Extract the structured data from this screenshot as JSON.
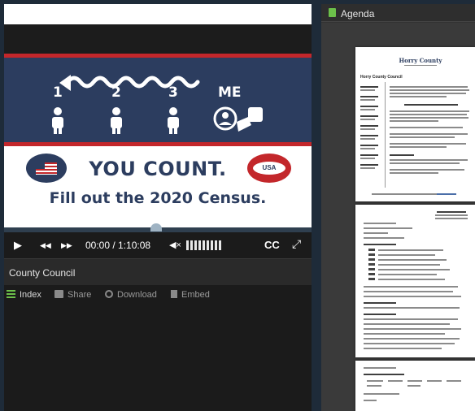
{
  "player": {
    "slide": {
      "numbers": [
        "1",
        "2",
        "3"
      ],
      "me_label": "ME",
      "headline": "YOU COUNT.",
      "usa_badge": "USA",
      "subline": "Fill out the 2020 Census."
    },
    "controls": {
      "play_icon": "▶",
      "rewind_icon": "◀◀",
      "forward_icon": "▶▶",
      "time": "00:00 / 1:10:08",
      "mute_icon": "◀×",
      "cc_label": "CC",
      "fullscreen_icon": "⤢"
    },
    "title": "County Council",
    "tabs": [
      {
        "label": "Index",
        "icon": "list-icon"
      },
      {
        "label": "Share",
        "icon": "share-icon"
      },
      {
        "label": "Download",
        "icon": "download-icon"
      },
      {
        "label": "Embed",
        "icon": "embed-icon"
      }
    ]
  },
  "agenda": {
    "title": "Agenda",
    "icon": "document-icon",
    "doc_logo": "Horry County",
    "doc_heading": "Horry County Council"
  },
  "colors": {
    "slide_navy": "#2c3d5f",
    "slide_red": "#c3272b",
    "accent_green": "#6cc04a",
    "panel_dark": "#1b1b1b"
  }
}
